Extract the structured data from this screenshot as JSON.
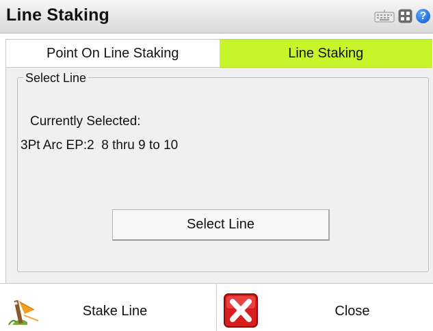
{
  "window": {
    "title": "Line Staking"
  },
  "titlebar_icons": [
    "keyboard-icon",
    "apps-icon",
    "help-icon"
  ],
  "tabs": [
    {
      "label": "Point On Line Staking",
      "active": false
    },
    {
      "label": "Line Staking",
      "active": true
    }
  ],
  "group": {
    "legend": "Select Line",
    "current_label": "Currently Selected:",
    "current_value": "3Pt Arc EP:2  8 thru 9 to 10",
    "select_button": "Select Line"
  },
  "bottom": {
    "stake_label": "Stake Line",
    "close_label": "Close"
  },
  "colors": {
    "active_tab": "#c6f52b",
    "background": "#f0f0f0",
    "close_red": "#d81e1e"
  }
}
